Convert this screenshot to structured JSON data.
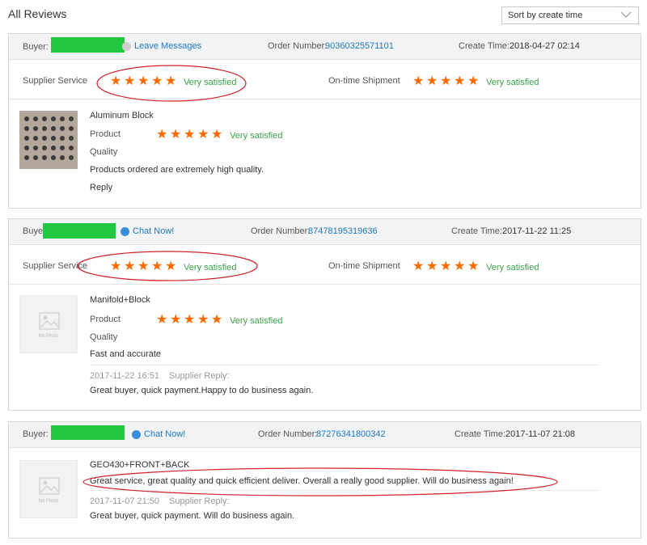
{
  "page": {
    "title": "All Reviews"
  },
  "sort": {
    "label": "Sort by create time"
  },
  "labels": {
    "buyer": "Buyer:",
    "order_number": "Order Number:",
    "create_time": "Create Time:",
    "supplier_service": "Supplier Service",
    "ontime_shipment": "On-time Shipment",
    "product": "Product",
    "quality": "Quality",
    "no_photo": "No Photo",
    "supplier_reply": "Supplier Reply:"
  },
  "colors": {
    "star": "#ff6a00",
    "satisfied": "#3aa24a",
    "link": "#1b78c2",
    "redacted": "#22c840",
    "annotation": "#d0202a"
  },
  "reviews": [
    {
      "message_link": "Leave Messages",
      "order_number": "90360325571101",
      "create_time": "2018-04-27 02:14",
      "supplier_service": {
        "stars": 5,
        "text": "Very satisfied"
      },
      "ontime_shipment": {
        "stars": 5,
        "text": "Very satisfied"
      },
      "product_name": "Aluminum Block",
      "product_rating": {
        "stars": 5,
        "text": "Very satisfied"
      },
      "comment": "Products ordered are extremely high quality.",
      "reply_link": "Reply"
    },
    {
      "message_link": "Chat Now!",
      "order_number": "87478195319636",
      "create_time": "2017-11-22 11:25",
      "supplier_service": {
        "stars": 5,
        "text": "Very satisfied"
      },
      "ontime_shipment": {
        "stars": 5,
        "text": "Very satisfied"
      },
      "product_name": "Manifold+Block",
      "product_rating": {
        "stars": 5,
        "text": "Very satisfied"
      },
      "comment": "Fast and accurate",
      "reply_time": "2017-11-22 16:51",
      "reply_text": "Great buyer, quick payment.Happy to do business again."
    },
    {
      "message_link": "Chat Now!",
      "order_number": "87276341800342",
      "create_time": "2017-11-07 21:08",
      "product_name": "GEO430+FRONT+BACK",
      "comment": "Great service, great quality and quick efficient deliver. Overall a really good supplier. Will do business again!",
      "reply_time": "2017-11-07 21:50",
      "reply_text": "Great buyer, quick payment. Will do business again."
    }
  ]
}
